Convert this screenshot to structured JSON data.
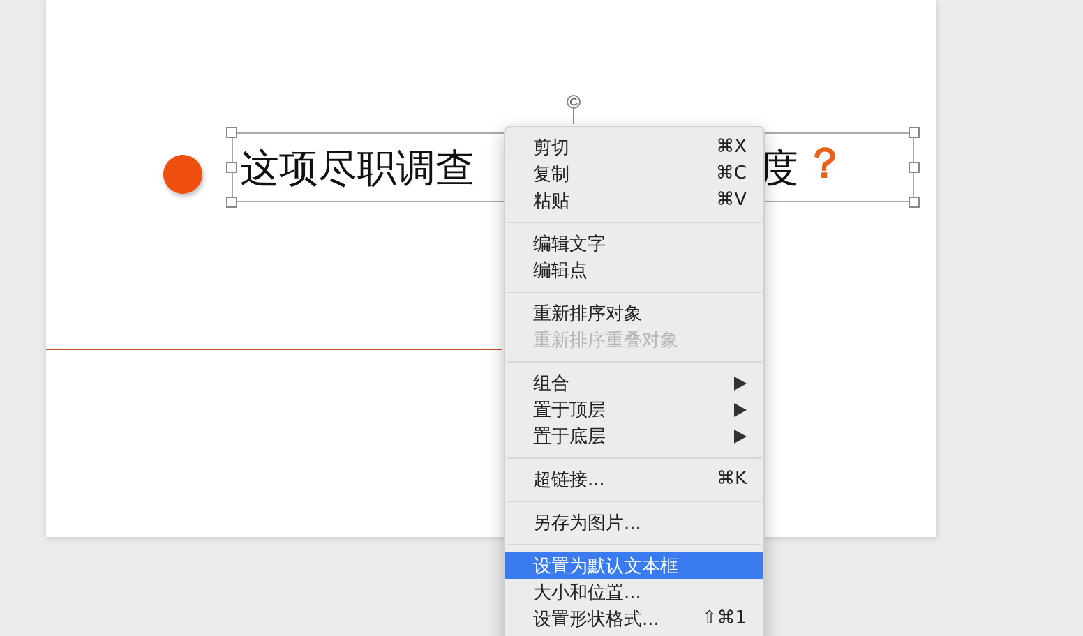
{
  "slide": {
    "text_before": "这项尽职调查",
    "text_after": "度",
    "question_mark": "？"
  },
  "context_menu": {
    "groups": [
      [
        {
          "label": "剪切",
          "shortcut": "⌘X",
          "kind": "plain",
          "disabled": false,
          "selected": false
        },
        {
          "label": "复制",
          "shortcut": "⌘C",
          "kind": "plain",
          "disabled": false,
          "selected": false
        },
        {
          "label": "粘贴",
          "shortcut": "⌘V",
          "kind": "plain",
          "disabled": false,
          "selected": false
        }
      ],
      [
        {
          "label": "编辑文字",
          "kind": "plain",
          "disabled": false,
          "selected": false
        },
        {
          "label": "编辑点",
          "kind": "plain",
          "disabled": false,
          "selected": false
        }
      ],
      [
        {
          "label": "重新排序对象",
          "kind": "plain",
          "disabled": false,
          "selected": false
        },
        {
          "label": "重新排序重叠对象",
          "kind": "plain",
          "disabled": true,
          "selected": false
        }
      ],
      [
        {
          "label": "组合",
          "kind": "submenu",
          "disabled": false,
          "selected": false
        },
        {
          "label": "置于顶层",
          "kind": "submenu",
          "disabled": false,
          "selected": false
        },
        {
          "label": "置于底层",
          "kind": "submenu",
          "disabled": false,
          "selected": false
        }
      ],
      [
        {
          "label": "超链接...",
          "shortcut": "⌘K",
          "kind": "plain",
          "disabled": false,
          "selected": false
        }
      ],
      [
        {
          "label": "另存为图片...",
          "kind": "plain",
          "disabled": false,
          "selected": false
        }
      ],
      [
        {
          "label": "设置为默认文本框",
          "kind": "plain",
          "disabled": false,
          "selected": true
        },
        {
          "label": "大小和位置...",
          "kind": "plain",
          "disabled": false,
          "selected": false
        },
        {
          "label": "设置形状格式...",
          "shortcut": "⇧⌘1",
          "kind": "plain",
          "disabled": false,
          "selected": false
        }
      ]
    ]
  }
}
